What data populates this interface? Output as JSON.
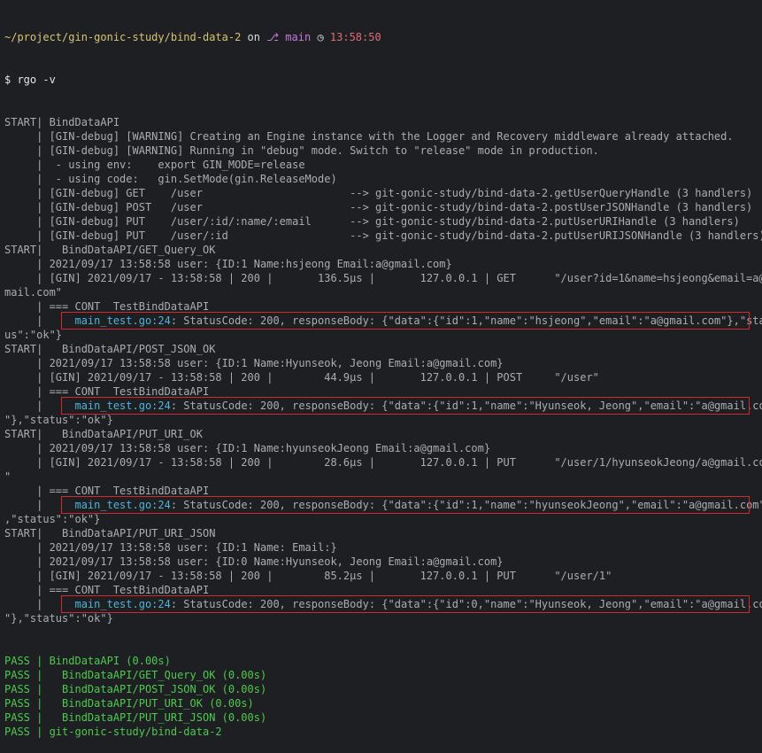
{
  "prompt_line": {
    "path": "~/project/gin-gonic-study/bind-data-2",
    "on": "on",
    "git_icon": "git-branch-icon",
    "branch": "main",
    "clock_icon": "clock-icon",
    "time": "13:58:50"
  },
  "command": "$ rgo -v",
  "lines": [
    "START| BindDataAPI",
    "     | [GIN-debug] [WARNING] Creating an Engine instance with the Logger and Recovery middleware already attached.",
    "     | [GIN-debug] [WARNING] Running in \"debug\" mode. Switch to \"release\" mode in production.",
    "     |  - using env:    export GIN_MODE=release",
    "     |  - using code:   gin.SetMode(gin.ReleaseMode)",
    "     | [GIN-debug] GET    /user                       --> git-gonic-study/bind-data-2.getUserQueryHandle (3 handlers)",
    "     | [GIN-debug] POST   /user                       --> git-gonic-study/bind-data-2.postUserJSONHandle (3 handlers)",
    "     | [GIN-debug] PUT    /user/:id/:name/:email      --> git-gonic-study/bind-data-2.putUserURIHandle (3 handlers)",
    "     | [GIN-debug] PUT    /user/:id                   --> git-gonic-study/bind-data-2.putUserURIJSONHandle (3 handlers)",
    "START|   BindDataAPI/GET_Query_OK",
    "     | 2021/09/17 13:58:58 user: {ID:1 Name:hsjeong Email:a@gmail.com}",
    "     | [GIN] 2021/09/17 - 13:58:58 | 200 |       136.5µs |       127.0.0.1 | GET      \"/user?id=1&name=hsjeong&email=a@g",
    "mail.com\"",
    "     | === CONT  TestBindDataAPI",
    "@1",
    "us\":\"ok\"}",
    "START|   BindDataAPI/POST_JSON_OK",
    "     | 2021/09/17 13:58:58 user: {ID:1 Name:Hyunseok, Jeong Email:a@gmail.com}",
    "     | [GIN] 2021/09/17 - 13:58:58 | 200 |        44.9µs |       127.0.0.1 | POST     \"/user\"",
    "     | === CONT  TestBindDataAPI",
    "@2",
    "\"},\"status\":\"ok\"}",
    "START|   BindDataAPI/PUT_URI_OK",
    "     | 2021/09/17 13:58:58 user: {ID:1 Name:hyunseokJeong Email:a@gmail.com}",
    "     | [GIN] 2021/09/17 - 13:58:58 | 200 |        28.6µs |       127.0.0.1 | PUT      \"/user/1/hyunseokJeong/a@gmail.com",
    "\"",
    "     | === CONT  TestBindDataAPI",
    "@3",
    ",\"status\":\"ok\"}",
    "START|   BindDataAPI/PUT_URI_JSON",
    "     | 2021/09/17 13:58:58 user: {ID:1 Name: Email:}",
    "     | 2021/09/17 13:58:58 user: {ID:0 Name:Hyunseok, Jeong Email:a@gmail.com}",
    "     | [GIN] 2021/09/17 - 13:58:58 | 200 |        85.2µs |       127.0.0.1 | PUT      \"/user/1\"",
    "     | === CONT  TestBindDataAPI",
    "@4",
    "\"},\"status\":\"ok\"}"
  ],
  "test_lines": {
    "1": {
      "prefix": "     |     ",
      "file": "main_test.go:24",
      "rest": ": StatusCode: 200, responseBody: {\"data\":{\"id\":1,\"name\":\"hsjeong\",\"email\":\"a@gmail.com\"},\"stat"
    },
    "2": {
      "prefix": "     |     ",
      "file": "main_test.go:24",
      "rest": ": StatusCode: 200, responseBody: {\"data\":{\"id\":1,\"name\":\"Hyunseok, Jeong\",\"email\":\"a@gmail.com"
    },
    "3": {
      "prefix": "     |     ",
      "file": "main_test.go:24",
      "rest": ": StatusCode: 200, responseBody: {\"data\":{\"id\":1,\"name\":\"hyunseokJeong\",\"email\":\"a@gmail.com\"}"
    },
    "4": {
      "prefix": "     |     ",
      "file": "main_test.go:24",
      "rest": ": StatusCode: 200, responseBody: {\"data\":{\"id\":0,\"name\":\"Hyunseok, Jeong\",\"email\":\"a@gmail.com"
    }
  },
  "pass_lines": [
    "PASS | BindDataAPI (0.00s)",
    "PASS |   BindDataAPI/GET_Query_OK (0.00s)",
    "PASS |   BindDataAPI/POST_JSON_OK (0.00s)",
    "PASS |   BindDataAPI/PUT_URI_OK (0.00s)",
    "PASS |   BindDataAPI/PUT_URI_JSON (0.00s)",
    "PASS | git-gonic-study/bind-data-2"
  ],
  "colors": {
    "background": "#1e1f22",
    "text": "#a9adb3",
    "path": "#d7c472",
    "branch": "#c678dd",
    "time": "#e06c75",
    "file": "#4fb3d9",
    "pass": "#4ec94e",
    "highlight": "#d02a2a"
  }
}
